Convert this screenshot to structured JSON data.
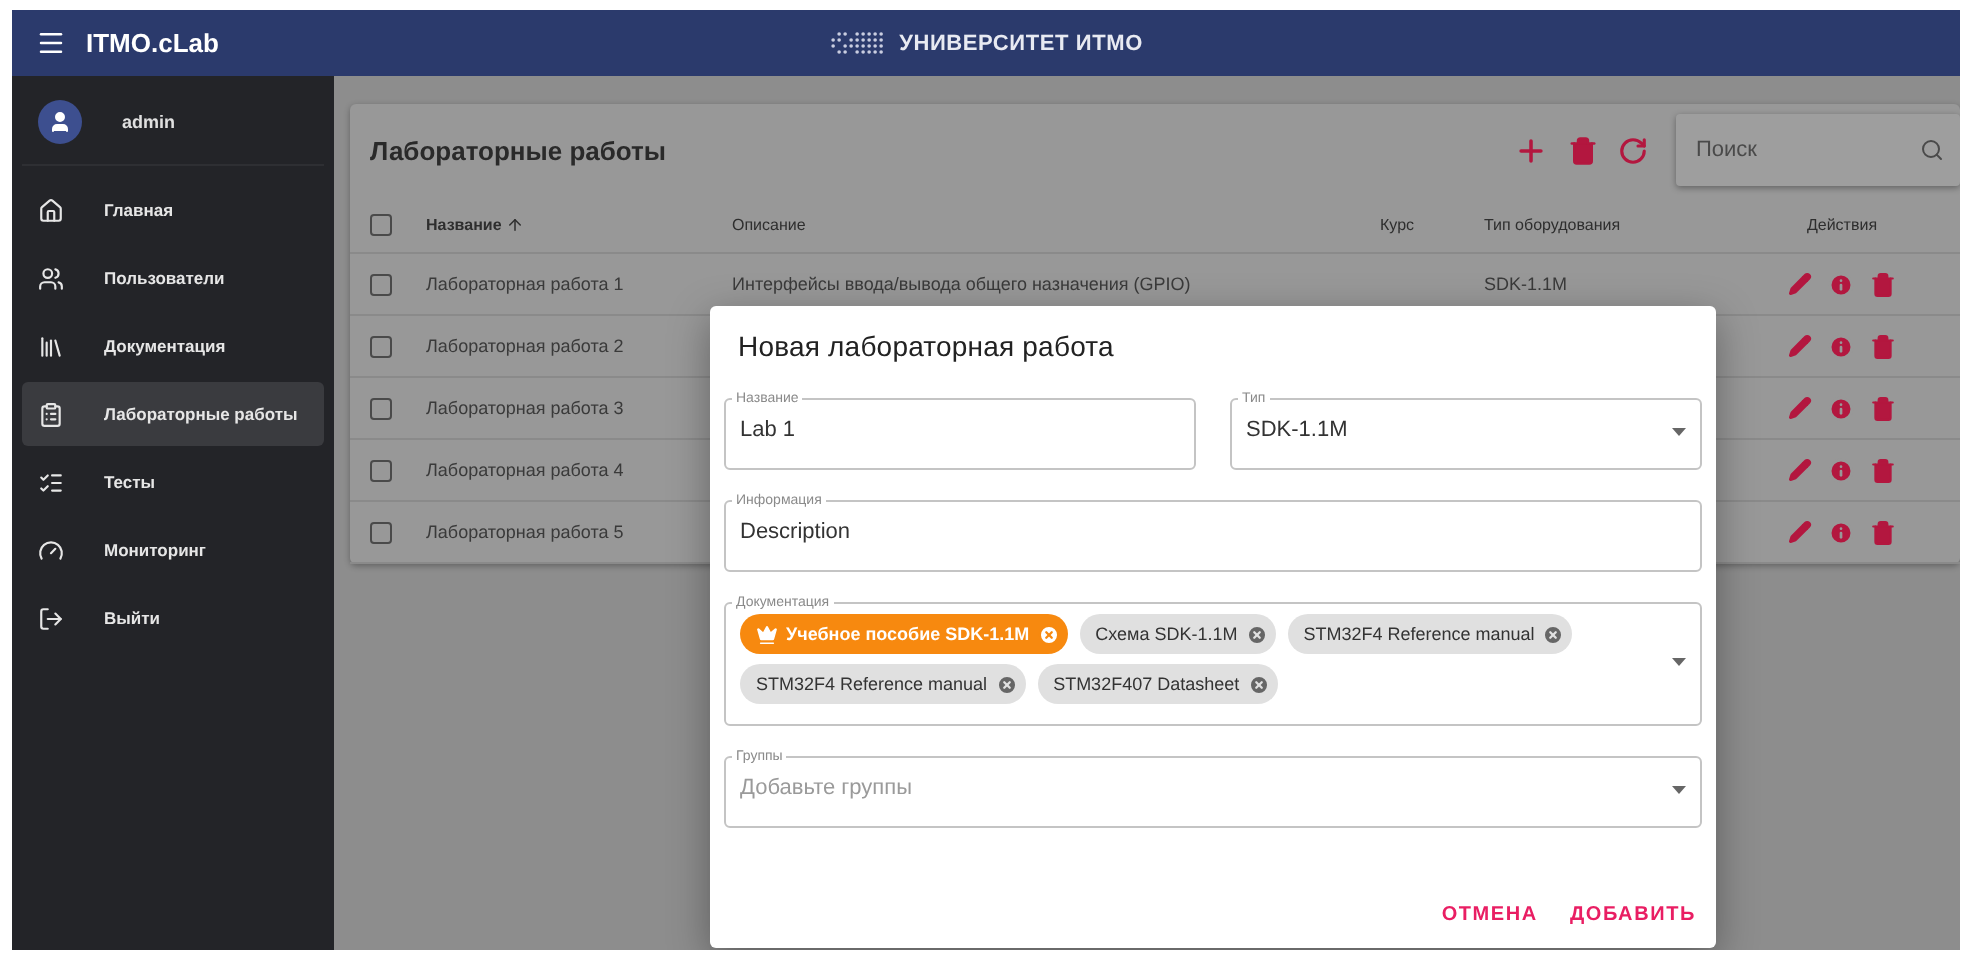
{
  "app": {
    "title": "ITMO.cLab",
    "brand": "УНИВЕРСИТЕТ ИТМО"
  },
  "sidebar": {
    "user": "admin",
    "items": [
      {
        "kind": "home",
        "label": "Главная",
        "selected": false
      },
      {
        "kind": "users",
        "label": "Пользователи",
        "selected": false
      },
      {
        "kind": "docs",
        "label": "Документация",
        "selected": false
      },
      {
        "kind": "labs",
        "label": "Лабораторные работы",
        "selected": true
      },
      {
        "kind": "tests",
        "label": "Тесты",
        "selected": false
      },
      {
        "kind": "monitor",
        "label": "Мониторинг",
        "selected": false
      },
      {
        "kind": "exit",
        "label": "Выйти",
        "selected": false
      }
    ]
  },
  "page": {
    "title": "Лабораторные работы",
    "search": {
      "placeholder": "Поиск"
    }
  },
  "table": {
    "all_checked": false,
    "columns": [
      {
        "label": "Название",
        "sorted": true
      },
      {
        "label": "Описание",
        "sorted": false
      },
      {
        "label": "Курс",
        "sorted": false
      },
      {
        "label": "Тип оборудования",
        "sorted": false
      },
      {
        "label": "Действия",
        "sorted": false
      }
    ],
    "rows": [
      {
        "name": "Лабораторная работа 1",
        "description": "Интерфейсы ввода/вывода общего назначения (GPIO)",
        "type": "SDK-1.1M",
        "checked": false
      },
      {
        "name": "Лабораторная работа 2",
        "checked": false
      },
      {
        "name": "Лабораторная работа 3",
        "checked": false
      },
      {
        "name": "Лабораторная работа 4",
        "checked": false
      },
      {
        "name": "Лабораторная работа 5",
        "checked": false
      }
    ]
  },
  "dialog": {
    "title": "Новая лабораторная работа",
    "field_rows": [
      [
        {
          "kind": "text",
          "label": "Название",
          "value": "Lab 1"
        },
        {
          "kind": "select",
          "label": "Тип",
          "value": "SDK-1.1M"
        }
      ],
      [
        {
          "kind": "text",
          "label": "Информация",
          "value": "Description"
        }
      ],
      [
        {
          "kind": "chips",
          "label": "Документация",
          "chips": [
            {
              "label": "Учебное пособие SDK-1.1M",
              "primary": true
            },
            {
              "label": "Схема SDK-1.1M",
              "primary": false
            },
            {
              "label": "STM32F4 Reference manual",
              "primary": false
            },
            {
              "label": "STM32F4 Reference manual",
              "primary": false
            },
            {
              "label": "STM32F407 Datasheet",
              "primary": false
            }
          ]
        }
      ],
      [
        {
          "kind": "select",
          "label": "Группы",
          "placeholder": "Добавьте группы"
        }
      ]
    ],
    "buttons": [
      "ОТМЕНА",
      "ДОБАВИТЬ"
    ]
  }
}
